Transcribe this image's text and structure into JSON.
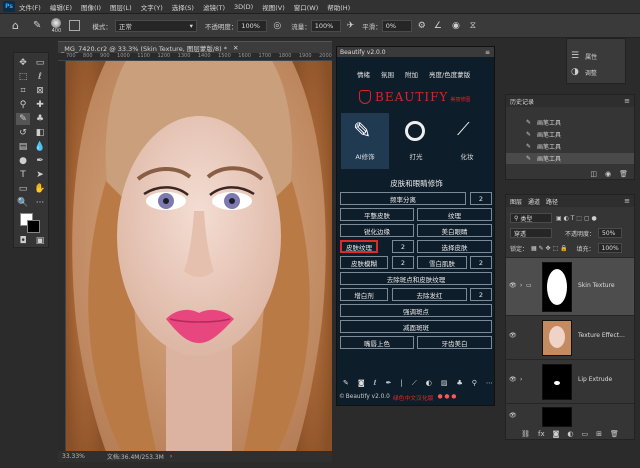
{
  "menubar": {
    "logo": "Ps",
    "items": [
      "文件(F)",
      "编辑(E)",
      "图像(I)",
      "图层(L)",
      "文字(Y)",
      "选择(S)",
      "滤镜(T)",
      "3D(D)",
      "视图(V)",
      "窗口(W)",
      "帮助(H)"
    ]
  },
  "options": {
    "brush_size": "400",
    "mode_label": "模式：",
    "mode_value": "正常",
    "opacity_label": "不透明度：",
    "opacity_value": "100%",
    "flow_label": "流量：",
    "flow_value": "100%",
    "smooth_label": "平滑：",
    "smooth_value": "0%"
  },
  "document": {
    "tab_title": "_MG_7420.cr2 @ 33.3% (Skin Texture, 图层蒙版/8) *",
    "ruler_marks": [
      "700",
      "800",
      "900",
      "1000",
      "1100",
      "1200",
      "1300",
      "1400",
      "1500",
      "1600",
      "1700",
      "1800",
      "1900",
      "2000"
    ],
    "zoom": "33.33%",
    "doc_info": "文档:36.4M/253.3M"
  },
  "beautify": {
    "window_title": "Beautify v2.0.0",
    "nav": [
      "情绪",
      "氛围",
      "附加",
      "亮度/色度蒙版"
    ],
    "logo_text": "BEAUTIFY",
    "logo_sub": "美丽修图",
    "categories": [
      {
        "label": "AI修饰",
        "icon": "brush-icon"
      },
      {
        "label": "打光",
        "icon": "light-icon"
      },
      {
        "label": "化妆",
        "icon": "makeup-icon"
      }
    ],
    "section_title": "皮肤和眼睛修饰",
    "buttons": {
      "freq": "频率分离",
      "freq_n": "2",
      "smooth": "平整皮肤",
      "texture": "纹理",
      "sharpen": "锐化边缘",
      "whiten": "美白眼睛",
      "skin_texture": "皮肤纹理",
      "skin_texture_n": "2",
      "select_skin": "选择皮肤",
      "blur_skin": "皮肤模糊",
      "blur_skin_n": "2",
      "snow_skin": "雪白肌肤",
      "snow_skin_n": "2",
      "remove_spots": "去除斑点和皮肤纹理",
      "highlight": "增白剂",
      "remove_hair": "去除发红",
      "remove_hair_n": "2",
      "strengthen": "强调斑点",
      "reduce": "减面斑斑",
      "lip_color": "嘴唇上色",
      "teeth": "牙齿美白"
    },
    "footer": "Beautify v2.0.0",
    "footer_red": "绿色中文汉化版"
  },
  "right": {
    "props_label": "属性",
    "adjust_label": "调整"
  },
  "history": {
    "title": "历史记录",
    "items": [
      "画笔工具",
      "画笔工具",
      "画笔工具",
      "画笔工具"
    ]
  },
  "layers": {
    "tabs": [
      "图层",
      "通道",
      "路径"
    ],
    "kind": "类型",
    "blend": "穿透",
    "opacity_label": "不透明度：",
    "opacity": "50%",
    "lock_label": "锁定：",
    "fill_label": "填充：",
    "fill": "100%",
    "rows": [
      {
        "name": "Skin Texture"
      },
      {
        "name": "Texture Effect..."
      },
      {
        "name": "Lip Extrude"
      },
      {
        "name": ""
      }
    ]
  },
  "colors": {
    "accent": "#31a8ff",
    "beautify_bg": "#0e1d2a",
    "highlight": "#e0292b",
    "logo_red": "#d9232b"
  }
}
